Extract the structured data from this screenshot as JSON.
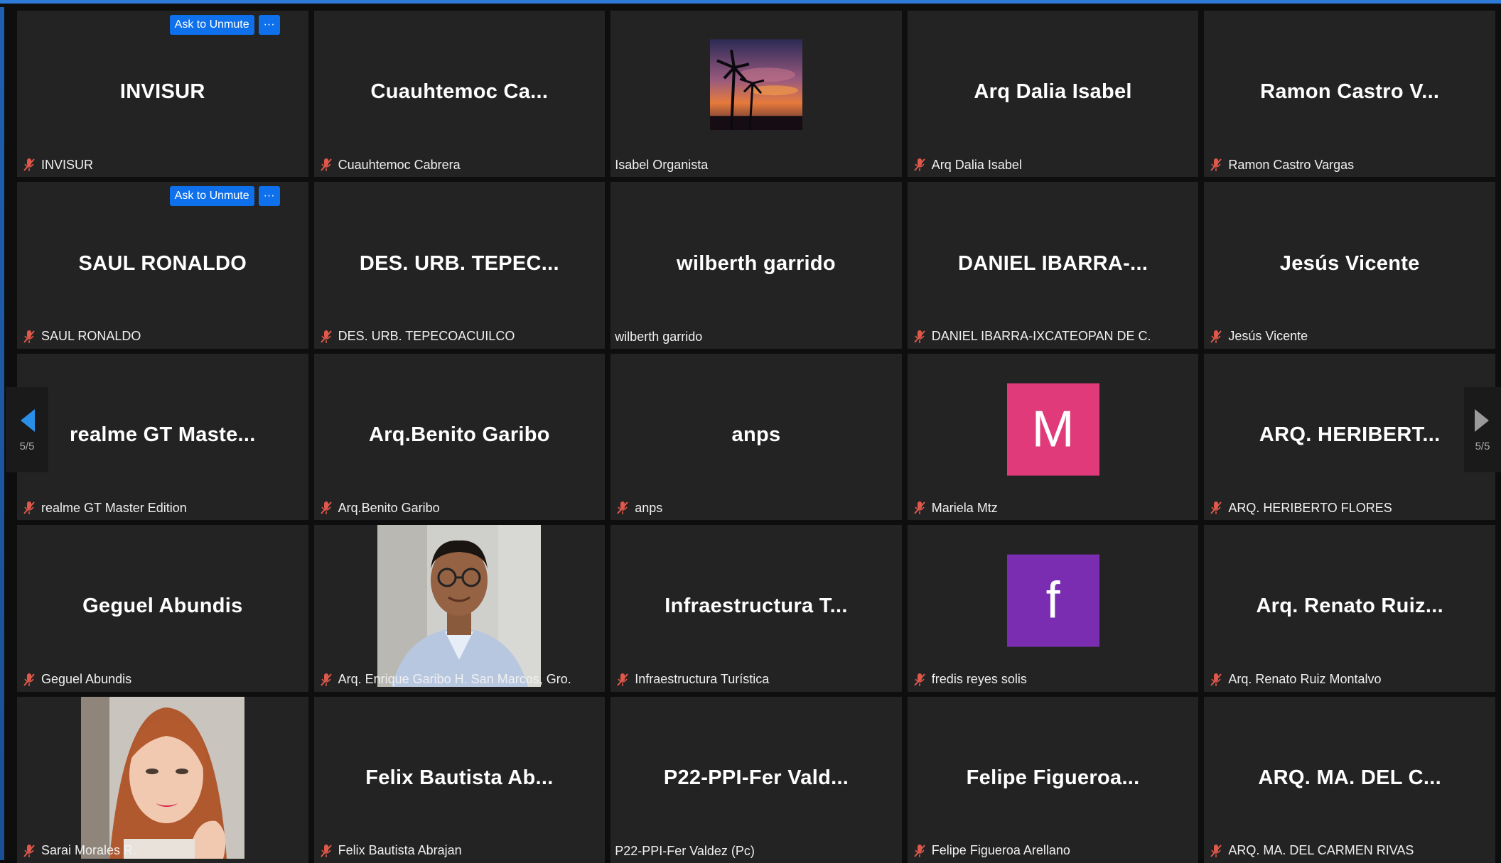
{
  "colors": {
    "accent": "#0e71eb",
    "tile_bg": "#232323",
    "muted_icon": "#e0584a",
    "avatar_m": "#e03a7a",
    "avatar_f": "#7a2db0"
  },
  "controls": {
    "ask_to_unmute": "Ask to Unmute",
    "more": "···"
  },
  "pagination": {
    "left_page": "5/5",
    "right_page": "5/5"
  },
  "tiles": [
    {
      "center": "INVISUR",
      "label": "INVISUR"
    },
    {
      "center": "Cuauhtemoc  Ca...",
      "label": "Cuauhtemoc Cabrera"
    },
    {
      "center": "",
      "label": "Isabel Organista"
    },
    {
      "center": "Arq Dalia Isabel",
      "label": "Arq Dalia Isabel"
    },
    {
      "center": "Ramon Castro V...",
      "label": "Ramon Castro Vargas"
    },
    {
      "center": "SAUL RONALDO",
      "label": "SAUL RONALDO"
    },
    {
      "center": "DES. URB. TEPEC...",
      "label": "DES. URB. TEPECOACUILCO"
    },
    {
      "center": "wilberth garrido",
      "label": "wilberth garrido"
    },
    {
      "center": "DANIEL  IBARRA-...",
      "label": "DANIEL IBARRA-IXCATEOPAN DE C."
    },
    {
      "center": "Jesús Vicente",
      "label": "Jesús Vicente"
    },
    {
      "center": "realme GT Maste...",
      "label": "realme GT Master Edition"
    },
    {
      "center": "Arq.Benito Garibo",
      "label": "Arq.Benito Garibo"
    },
    {
      "center": "anps",
      "label": "anps"
    },
    {
      "center": "M",
      "label": "Mariela Mtz"
    },
    {
      "center": "ARQ.  HERIBERT...",
      "label": "ARQ. HERIBERTO FLORES"
    },
    {
      "center": "Geguel Abundis",
      "label": "Geguel Abundis"
    },
    {
      "center": "",
      "label": "Arq. Enrique Garibo H. San Marcos, Gro."
    },
    {
      "center": "Infraestructura  T...",
      "label": "Infraestructura Turística"
    },
    {
      "center": "f",
      "label": "fredis reyes solis"
    },
    {
      "center": "Arq.  Renato  Ruiz...",
      "label": "Arq. Renato Ruiz Montalvo"
    },
    {
      "center": "",
      "label": "Sarai Morales R."
    },
    {
      "center": "Felix Bautista Ab...",
      "label": "Felix Bautista Abrajan"
    },
    {
      "center": "P22-PPI-Fer Vald...",
      "label": "P22-PPI-Fer Valdez (Pc)"
    },
    {
      "center": "Felipe  Figueroa...",
      "label": "Felipe Figueroa Arellano"
    },
    {
      "center": "ARQ. MA. DEL C...",
      "label": "ARQ. MA. DEL CARMEN RIVAS"
    }
  ],
  "icons": {
    "muted": "microphone-muted-icon",
    "prev": "chevron-left-icon",
    "next": "chevron-right-icon"
  }
}
